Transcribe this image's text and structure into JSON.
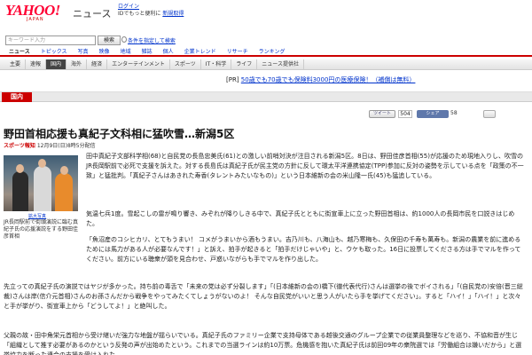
{
  "header": {
    "logo": "YAHOO!",
    "logo_sub": "JAPAN",
    "service": "ニュース",
    "login_label": "ログイン",
    "login_sub": "IDでもっと便利に",
    "register_link": "新規取得"
  },
  "search": {
    "placeholder": "キーワード入力",
    "button": "検索",
    "advanced": "条件を指定して検索"
  },
  "category_tabs": [
    "ニュース",
    "トピックス",
    "写真",
    "映像",
    "地域",
    "雑誌",
    "個人",
    "企業トレンド",
    "リサーチ",
    "ランキング"
  ],
  "sub_nav": [
    "主要",
    "速報",
    "国内",
    "海外",
    "経済",
    "エンターテインメント",
    "スポーツ",
    "IT・科学",
    "ライフ",
    "ニュース提供社"
  ],
  "pr": {
    "label": "[PR]",
    "text": "50歳でも70歳でも保険料3000円の医療保険！（補償は無料）"
  },
  "section": "国内",
  "social": {
    "tweet": "ツイート",
    "tweet_count": "504",
    "facebook": "シェア",
    "fb_count": "58"
  },
  "article": {
    "headline": "野田首相応援も真紀子文科相に猛吹雪…新潟5区",
    "source": "スポーツ報知",
    "date": "12月9日(日)8時5分配信",
    "photo_enlarge": "拡大写真",
    "photo_caption": "JR長岡駅前で街頭演説に臨む真紀子氏の応援演説をする野田佳彦首相",
    "paragraphs": [
      "田中真紀子文部科学相(68)と自民党の長島忠美氏(61)との激しい前哨対決が注目される新潟5区。8日は、野田佳彦首相(55)が応援のため現地入りし、吹雪のJR長岡駅前で必死で支援を訴えた。対する長島氏は真紀子氏が民主党の方針に反して環太平洋連携協定(TPP)参加に反対の姿勢を示している点を「政策の不一致」と猛批判。「真紀子さんはあきれた寿香(タレントみたいなもの)」という日本維新の会の米山隆一氏(45)も猛追している。",
      "気温七兵1度。雪起こしの雷が鳴り響き、みぞれが降りしきる中で、真紀子氏とともに街宣車上に立った野田首相は、約1000人の長岡市民を口説きはじめた。",
      "「魚沼産のコシヒカリ、とてもうまい！ コメがうまいから酒もうまい。吉乃川も、八海山も、越乃寒梅も、久保田の千寿も萬寿も。新潟の農業を前に進めるためには馬力がある人が必要なんです！」と訴え、拍手が起きると「拍手だけじゃいや」と、ウケも取った。16日に投票してくださる方は手でマルを作ってください。前方にいる聴衆が頭を見合わせ、戸惑いながらも手でマルを作り出した。",
      "先立っての真紀子氏の演説ではヤジが多かった。持ち前の毒舌で「未来の党は必ず分裂します」「(日本維新の会の)橋下(徹代表代行)さんは選挙の後でボイされる」「(自民党の)安倍(晋三総裁)さんは岸(信介元首相)さんのお孫さんだから戦争をやってみたくてしょうがないのよ！ そんな自民党がいいと思う人がいたら手を挙げてください」。すると「ハイ！」「ハイ！」と次々と手が挙がり、街宣車上から「どうしてよ！」と絶叫した。",
      "父親の故・田中角栄元首相から受け継いだ強力な地盤が揺らいでいる。真紀子氏のファミリー企業で支持母体である越後交通のグループ企業での従業員整理などを巡り、不協和音が生じ「組織として推す必要があるのかという反発の声が出始めたという。これまでの当選ラインは約10万票。危機感を抱いた真紀子氏は前回09年の衆院選では「労働組合は嫌いだから」と選挙協力を断った連合の支援を受け入れた。"
    ]
  }
}
